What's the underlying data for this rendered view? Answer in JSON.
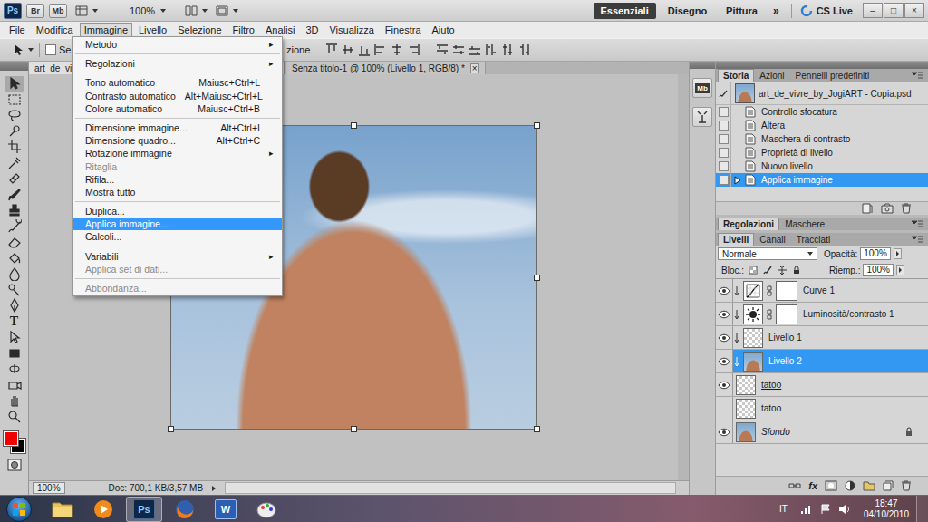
{
  "app_bar": {
    "logo": "Ps",
    "bridge_buttons": [
      "Br",
      "Mb"
    ],
    "zoom": "100%",
    "workspaces": [
      {
        "label": "Essenziali",
        "selected": true
      },
      {
        "label": "Disegno",
        "selected": false
      },
      {
        "label": "Pittura",
        "selected": false
      }
    ],
    "more": "»",
    "cs_live": "CS Live",
    "window_controls": [
      "–",
      "□",
      "×"
    ]
  },
  "menu_bar": [
    {
      "label": "File",
      "selected": false
    },
    {
      "label": "Modifica",
      "selected": false
    },
    {
      "label": "Immagine",
      "selected": true
    },
    {
      "label": "Livello",
      "selected": false
    },
    {
      "label": "Selezione",
      "selected": false
    },
    {
      "label": "Filtro",
      "selected": false
    },
    {
      "label": "Analisi",
      "selected": false
    },
    {
      "label": "3D",
      "selected": false
    },
    {
      "label": "Visualizza",
      "selected": false
    },
    {
      "label": "Finestra",
      "selected": false
    },
    {
      "label": "Aiuto",
      "selected": false
    }
  ],
  "image_menu": {
    "submenu_arrow": "▸",
    "entries": [
      {
        "kind": "item",
        "label": "Metodo",
        "shortcut": "",
        "submenu": true,
        "disabled": false,
        "selected": false
      },
      {
        "kind": "separator"
      },
      {
        "kind": "item",
        "label": "Regolazioni",
        "shortcut": "",
        "submenu": true,
        "disabled": false,
        "selected": false
      },
      {
        "kind": "separator"
      },
      {
        "kind": "item",
        "label": "Tono automatico",
        "shortcut": "Maiusc+Ctrl+L",
        "submenu": false,
        "disabled": false,
        "selected": false
      },
      {
        "kind": "item",
        "label": "Contrasto automatico",
        "shortcut": "Alt+Maiusc+Ctrl+L",
        "submenu": false,
        "disabled": false,
        "selected": false
      },
      {
        "kind": "item",
        "label": "Colore automatico",
        "shortcut": "Maiusc+Ctrl+B",
        "submenu": false,
        "disabled": false,
        "selected": false
      },
      {
        "kind": "separator"
      },
      {
        "kind": "item",
        "label": "Dimensione immagine...",
        "shortcut": "Alt+Ctrl+I",
        "submenu": false,
        "disabled": false,
        "selected": false
      },
      {
        "kind": "item",
        "label": "Dimensione quadro...",
        "shortcut": "Alt+Ctrl+C",
        "submenu": false,
        "disabled": false,
        "selected": false
      },
      {
        "kind": "item",
        "label": "Rotazione immagine",
        "shortcut": "",
        "submenu": true,
        "disabled": false,
        "selected": false
      },
      {
        "kind": "item",
        "label": "Ritaglia",
        "shortcut": "",
        "submenu": false,
        "disabled": true,
        "selected": false
      },
      {
        "kind": "item",
        "label": "Rifila...",
        "shortcut": "",
        "submenu": false,
        "disabled": false,
        "selected": false
      },
      {
        "kind": "item",
        "label": "Mostra tutto",
        "shortcut": "",
        "submenu": false,
        "disabled": false,
        "selected": false
      },
      {
        "kind": "separator"
      },
      {
        "kind": "item",
        "label": "Duplica...",
        "shortcut": "",
        "submenu": false,
        "disabled": false,
        "selected": false
      },
      {
        "kind": "item",
        "label": "Applica immagine...",
        "shortcut": "",
        "submenu": false,
        "disabled": false,
        "selected": true
      },
      {
        "kind": "item",
        "label": "Calcoli...",
        "shortcut": "",
        "submenu": false,
        "disabled": false,
        "selected": false
      },
      {
        "kind": "separator"
      },
      {
        "kind": "item",
        "label": "Variabili",
        "shortcut": "",
        "submenu": true,
        "disabled": false,
        "selected": false
      },
      {
        "kind": "item",
        "label": "Applica set di dati...",
        "shortcut": "",
        "submenu": false,
        "disabled": true,
        "selected": false
      },
      {
        "kind": "separator"
      },
      {
        "kind": "item",
        "label": "Abbondanza...",
        "shortcut": "",
        "submenu": false,
        "disabled": true,
        "selected": false
      }
    ]
  },
  "options_bar": {
    "checkbox_label": "Se",
    "checked": false,
    "trailing_text": "zione"
  },
  "document_tabs": [
    {
      "label": "art_de_vivr",
      "selected": true,
      "close": ""
    },
    {
      "label": "Senza titolo-1 @ 100% (Livello 1, RGB/8) *",
      "selected": false,
      "close": "×"
    }
  ],
  "toolbar": {
    "type_glyph": "T"
  },
  "status_bar": {
    "zoom": "100%",
    "doc": "Doc: 700,1 KB/3,57 MB"
  },
  "dock": {
    "mini_bridge": "Mb"
  },
  "history_panel": {
    "tabs": [
      {
        "label": "Storia",
        "selected": true
      },
      {
        "label": "Azioni",
        "selected": false
      },
      {
        "label": "Pennelli predefiniti",
        "selected": false
      }
    ],
    "snapshot": "art_de_vivre_by_JogiART - Copia.psd",
    "steps": [
      {
        "label": "Controllo sfocatura",
        "selected": false
      },
      {
        "label": "Altera",
        "selected": false
      },
      {
        "label": "Maschera di contrasto",
        "selected": false
      },
      {
        "label": "Proprietà di livello",
        "selected": false
      },
      {
        "label": "Nuovo livello",
        "selected": false
      },
      {
        "label": "Applica immagine",
        "selected": true
      }
    ]
  },
  "adjustments_tabs": [
    {
      "label": "Regolazioni",
      "selected": true
    },
    {
      "label": "Maschere",
      "selected": false
    }
  ],
  "layers_panel": {
    "tabs": [
      {
        "label": "Livelli",
        "selected": true
      },
      {
        "label": "Canali",
        "selected": false
      },
      {
        "label": "Tracciati",
        "selected": false
      }
    ],
    "blend_mode": "Normale",
    "opacity_label": "Opacità:",
    "opacity": "100%",
    "lock_label": "Bloc.:",
    "fill_label": "Riemp.:",
    "fill": "100%",
    "layers": [
      {
        "name": "Curve 1",
        "kind": "curves",
        "visible": true,
        "selected": false,
        "clipped": true,
        "clip_base": false,
        "background": false,
        "locked": false
      },
      {
        "name": "Luminosità/contrasto 1",
        "kind": "brightness",
        "visible": true,
        "selected": false,
        "clipped": true,
        "clip_base": false,
        "background": false,
        "locked": false
      },
      {
        "name": "Livello 1",
        "kind": "transparent",
        "visible": true,
        "selected": false,
        "clipped": true,
        "clip_base": false,
        "background": false,
        "locked": false
      },
      {
        "name": "Livello 2",
        "kind": "photo",
        "visible": true,
        "selected": true,
        "clipped": true,
        "clip_base": false,
        "background": false,
        "locked": false
      },
      {
        "name": "tatoo",
        "kind": "transparent",
        "visible": true,
        "selected": false,
        "clipped": false,
        "clip_base": true,
        "background": false,
        "locked": false
      },
      {
        "name": "tatoo",
        "kind": "transparent",
        "visible": false,
        "selected": false,
        "clipped": false,
        "clip_base": false,
        "background": false,
        "locked": false
      },
      {
        "name": "Sfondo",
        "kind": "photo",
        "visible": true,
        "selected": false,
        "clipped": false,
        "clip_base": false,
        "background": true,
        "locked": true
      }
    ],
    "footer_fx": "fx"
  },
  "taskbar": {
    "apps": [
      {
        "kind": "explorer",
        "label": "",
        "selected": false
      },
      {
        "kind": "media",
        "label": "",
        "selected": false
      },
      {
        "kind": "photoshop",
        "label": "Ps",
        "selected": true
      },
      {
        "kind": "firefox",
        "label": "",
        "selected": false
      },
      {
        "kind": "word",
        "label": "W",
        "selected": false
      },
      {
        "kind": "paint",
        "label": "",
        "selected": false
      }
    ],
    "language": "IT",
    "time": "18:47",
    "date": "04/10/2010"
  }
}
